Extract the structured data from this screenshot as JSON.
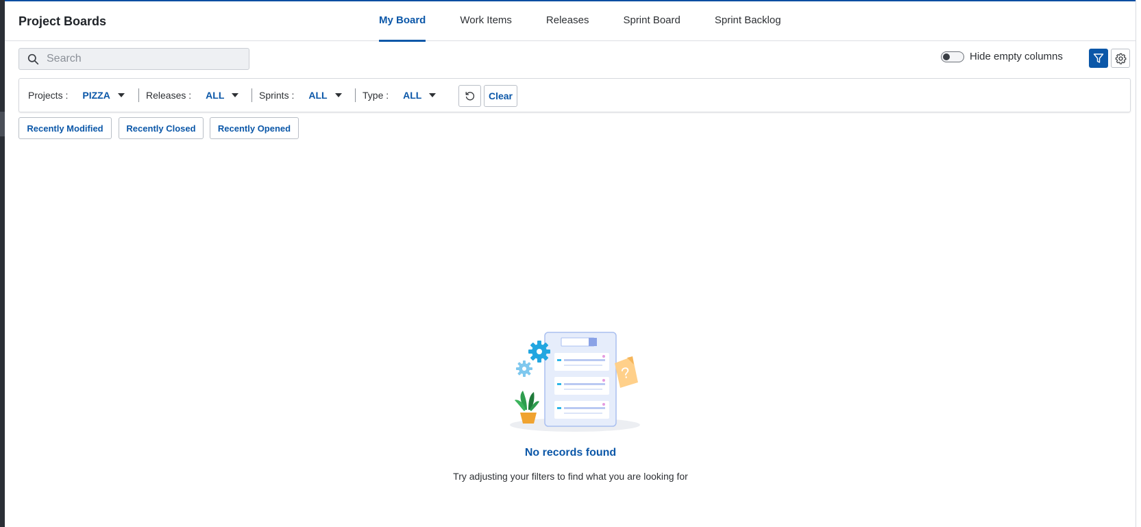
{
  "header": {
    "title": "Project Boards",
    "tabs": [
      {
        "label": "My Board",
        "active": true
      },
      {
        "label": "Work Items",
        "active": false
      },
      {
        "label": "Releases",
        "active": false
      },
      {
        "label": "Sprint Board",
        "active": false
      },
      {
        "label": "Sprint Backlog",
        "active": false
      }
    ]
  },
  "toolbar": {
    "search_placeholder": "Search",
    "search_value": "",
    "hide_empty_columns_label": "Hide empty columns",
    "hide_empty_columns_on": false,
    "filter_icon": "filter-icon",
    "settings_icon": "gear-icon"
  },
  "filters": {
    "projects": {
      "label": "Projects :",
      "value": "PIZZA"
    },
    "releases": {
      "label": "Releases :",
      "value": "ALL"
    },
    "sprints": {
      "label": "Sprints :",
      "value": "ALL"
    },
    "type": {
      "label": "Type :",
      "value": "ALL"
    },
    "reset_icon": "refresh-icon",
    "clear_label": "Clear"
  },
  "quick_filters": [
    {
      "label": "Recently Modified"
    },
    {
      "label": "Recently Closed"
    },
    {
      "label": "Recently Opened"
    }
  ],
  "empty_state": {
    "title": "No records found",
    "subtitle": "Try adjusting your filters to find what you are looking for"
  },
  "colors": {
    "accent": "#0b57a8",
    "empty_title": "#0b57a8"
  }
}
